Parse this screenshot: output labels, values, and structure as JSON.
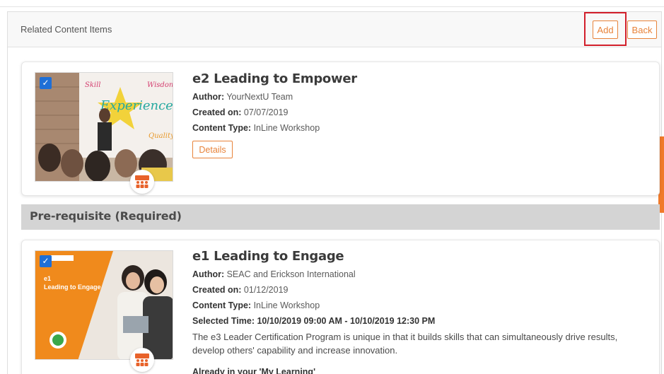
{
  "panel": {
    "title": "Related Content Items",
    "add_label": "Add",
    "back_label": "Back"
  },
  "items": [
    {
      "title": "e2 Leading to Empower",
      "author_label": "Author:",
      "author": " YourNextU Team",
      "created_label": "Created on:",
      "created": " 07/07/2019",
      "type_label": "Content Type:",
      "type": " InLine Workshop",
      "details_label": "Details",
      "thumbnail_words": [
        "Skill",
        "Wisdom",
        "Experience",
        "Quality"
      ],
      "thumbnail_icon": "presentation-audience",
      "checked": true
    },
    {
      "title": "e1 Leading to Engage",
      "author_label": "Author:",
      "author": " SEAC and Erickson International",
      "created_label": "Created on:",
      "created": " 01/12/2019",
      "type_label": "Content Type:",
      "type": " InLine Workshop",
      "selected_time": "Selected Time: 10/10/2019 09:00 AM - 10/10/2019 12:30 PM",
      "description": "The e3 Leader Certification Program is unique in that it builds skills that can simultaneously drive results, develop others' capability and increase innovation.",
      "already_label": "Already in your 'My Learning'",
      "thumbnail_text": "e1\nLeading to Engage",
      "thumbnail_line1": "e1",
      "thumbnail_line2": "Leading to Engage",
      "thumbnail_icon": "two-women-tablet",
      "checked": true
    }
  ],
  "section": {
    "prerequisite_title": "Pre-requisite (Required)"
  },
  "colors": {
    "accent": "#e8833a",
    "highlight": "#d21f2b",
    "check": "#1f6fd6",
    "section_bg": "#d4d4d4",
    "thumb_orange": "#f08a1c"
  }
}
